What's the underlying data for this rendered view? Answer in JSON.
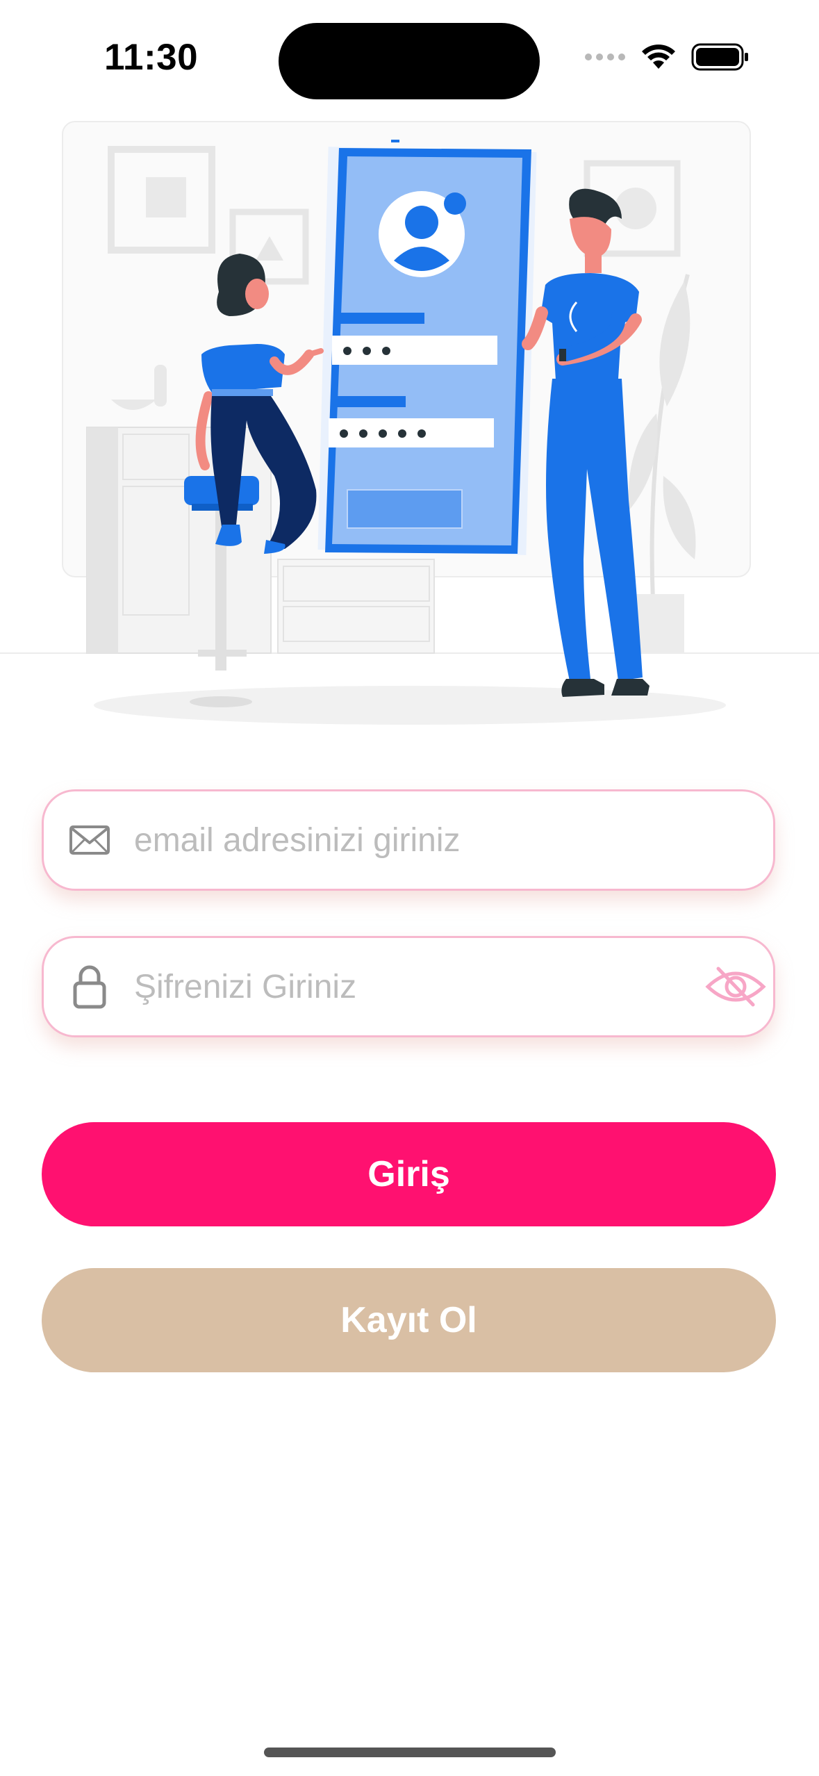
{
  "status_bar": {
    "time": "11:30"
  },
  "illustration": {
    "icon": "login-illustration",
    "dots_short": "• • •",
    "dots_long": "• • • • •"
  },
  "email_field": {
    "placeholder": "email adresinizi giriniz",
    "value": "",
    "icon": "envelope-icon"
  },
  "password_field": {
    "placeholder": "Şifrenizi Giriniz",
    "value": "",
    "icon": "lock-icon",
    "toggle_icon": "eye-off-icon"
  },
  "buttons": {
    "login_label": "Giriş",
    "register_label": "Kayıt Ol"
  },
  "colors": {
    "primary": "#ff1170",
    "secondary": "#d9bfa4",
    "field_border": "#f7b8cf",
    "illustration_blue": "#1a73e8"
  }
}
